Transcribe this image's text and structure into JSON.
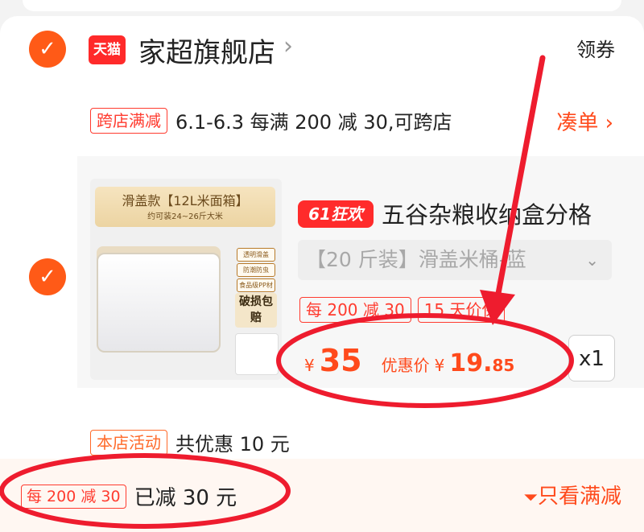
{
  "shop": {
    "platform_logo": "天猫",
    "name": "家超旗舰店",
    "coupon_label": "领券"
  },
  "promo": {
    "tag": "跨店满减",
    "text": "6.1-6.3 每满 200 减 30,可跨店",
    "action": "凑单 ›"
  },
  "product": {
    "image": {
      "banner_title": "滑盖款【12L米面箱】",
      "banner_sub": "约可装24~26斤大米",
      "features": [
        "透明滑盖",
        "防潮防虫",
        "食品级PP材质"
      ],
      "badge": "破损包赔"
    },
    "festival_tag": "61狂欢",
    "title": "五谷杂粮收纳盒分格",
    "sku": "【20 斤装】滑盖米桶-蓝",
    "tags": [
      "每 200 减 30",
      "15 天价保"
    ],
    "currency": "¥",
    "price": "35",
    "discount_label": "优惠价",
    "discount_price": "19.",
    "discount_cents": "85",
    "quantity": "x1"
  },
  "store_activity": {
    "tag": "本店活动",
    "text": "共优惠 10 元"
  },
  "bottom": {
    "tag": "每 200 减 30",
    "reduced_text": "已减 30 元",
    "filter_label": "只看满减"
  },
  "colors": {
    "accent": "#ff4a1c",
    "check": "#ff5a17",
    "annotation_red": "#ee1c2e"
  },
  "icons": [
    "check-icon",
    "chevron-right-icon",
    "chevron-down-icon",
    "filter-icon"
  ]
}
